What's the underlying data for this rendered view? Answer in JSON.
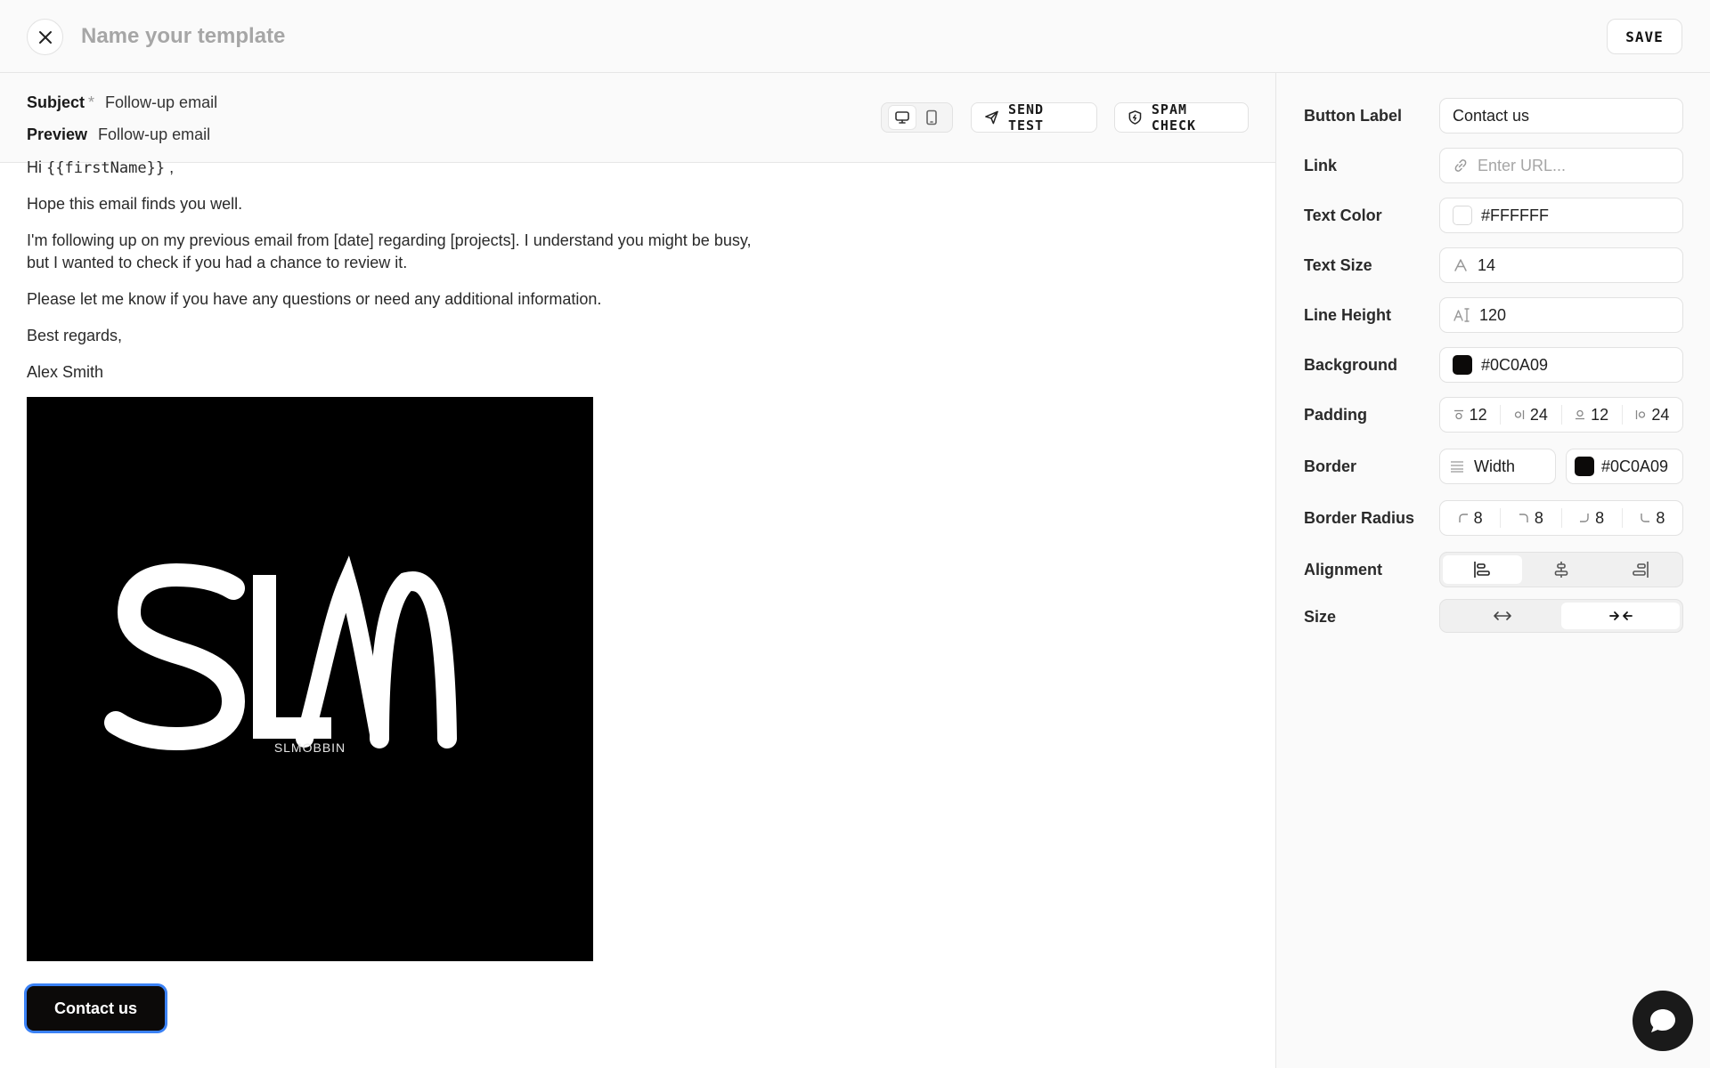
{
  "header": {
    "template_name_placeholder": "Name your template",
    "save_label": "SAVE"
  },
  "email": {
    "subject_label": "Subject",
    "subject_required_mark": "*",
    "subject_value": "Follow-up email",
    "preview_label": "Preview",
    "preview_value": "Follow-up email",
    "send_test_label": "SEND TEST",
    "spam_check_label": "SPAM CHECK",
    "greeting_prefix": "Hi",
    "greeting_variable": "{{firstName}}",
    "greeting_suffix": ",",
    "para1": "Hope this email finds you well.",
    "para2": "I'm following up on my previous email from [date] regarding [projects]. I understand you might be busy, but I wanted to check if you had a chance to review it.",
    "para3": "Please let me know if you have any questions or need any additional information.",
    "para4": "Best regards,",
    "para5": "Alex Smith",
    "logo_caption": "SLMOBBIN",
    "button_label": "Contact us"
  },
  "panel": {
    "button_label": {
      "label": "Button Label",
      "value": "Contact us"
    },
    "link": {
      "label": "Link",
      "placeholder": "Enter URL..."
    },
    "text_color": {
      "label": "Text Color",
      "value": "#FFFFFF"
    },
    "text_size": {
      "label": "Text Size",
      "value": "14"
    },
    "line_height": {
      "label": "Line Height",
      "value": "120"
    },
    "background": {
      "label": "Background",
      "value": "#0C0A09"
    },
    "padding": {
      "label": "Padding",
      "top": "12",
      "right": "24",
      "bottom": "12",
      "left": "24"
    },
    "border": {
      "label": "Border",
      "width_placeholder": "Width",
      "color": "#0C0A09"
    },
    "border_radius": {
      "label": "Border Radius",
      "tl": "8",
      "tr": "8",
      "br": "8",
      "bl": "8"
    },
    "alignment": {
      "label": "Alignment",
      "selected": "left"
    },
    "size": {
      "label": "Size",
      "selected": "fit"
    }
  },
  "colors": {
    "button_bg": "#0C0A09",
    "focus_ring": "#3B82F6",
    "text_color": "#FFFFFF"
  },
  "icons": [
    "close-icon",
    "desktop-icon",
    "mobile-icon",
    "send-icon",
    "shield-icon",
    "link-icon",
    "text-size-icon",
    "line-height-icon",
    "align-left-icon",
    "align-center-icon",
    "align-right-icon",
    "expand-icon",
    "shrink-icon",
    "chat-icon"
  ]
}
